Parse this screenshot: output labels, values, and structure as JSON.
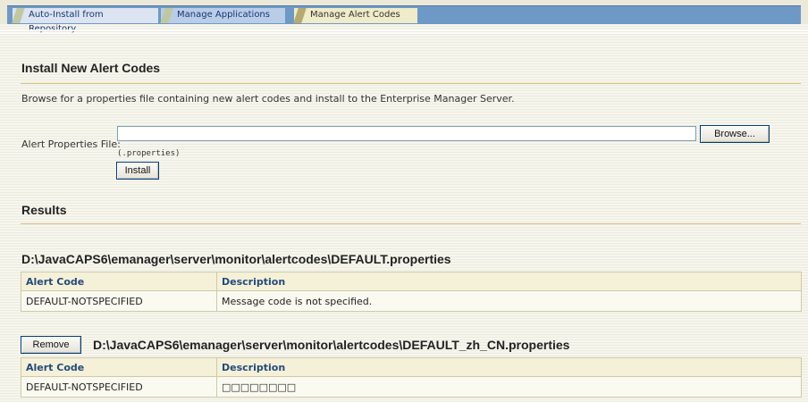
{
  "tabs": [
    {
      "label": "Auto-Install from Repository",
      "active": false
    },
    {
      "label": "Manage Applications",
      "active": false
    },
    {
      "label": "Manage Alert Codes",
      "active": true
    }
  ],
  "install_section": {
    "heading": "Install New Alert Codes",
    "description": "Browse for a properties file containing new alert codes and install to the Enterprise Manager Server.",
    "field_label": "Alert Properties File:",
    "file_value": "",
    "browse_label": "Browse...",
    "hint": "(.properties)",
    "install_label": "Install"
  },
  "results": {
    "heading": "Results",
    "files": [
      {
        "path": "D:\\JavaCAPS6\\emanager\\server\\monitor\\alertcodes\\DEFAULT.properties",
        "removable": false,
        "columns": [
          "Alert Code",
          "Description"
        ],
        "rows": [
          [
            "DEFAULT-NOTSPECIFIED",
            "Message code is not specified."
          ]
        ]
      },
      {
        "path": "D:\\JavaCAPS6\\emanager\\server\\monitor\\alertcodes\\DEFAULT_zh_CN.properties",
        "removable": true,
        "remove_label": "Remove",
        "columns": [
          "Alert Code",
          "Description"
        ],
        "rows": [
          [
            "DEFAULT-NOTSPECIFIED",
            "□□□□□□□□"
          ]
        ]
      }
    ]
  },
  "colors": {
    "tab_bar": "#6e98c6",
    "active_tab": "#f0ebc9",
    "header_text": "#254a7a",
    "rule": "#e0bf84"
  }
}
